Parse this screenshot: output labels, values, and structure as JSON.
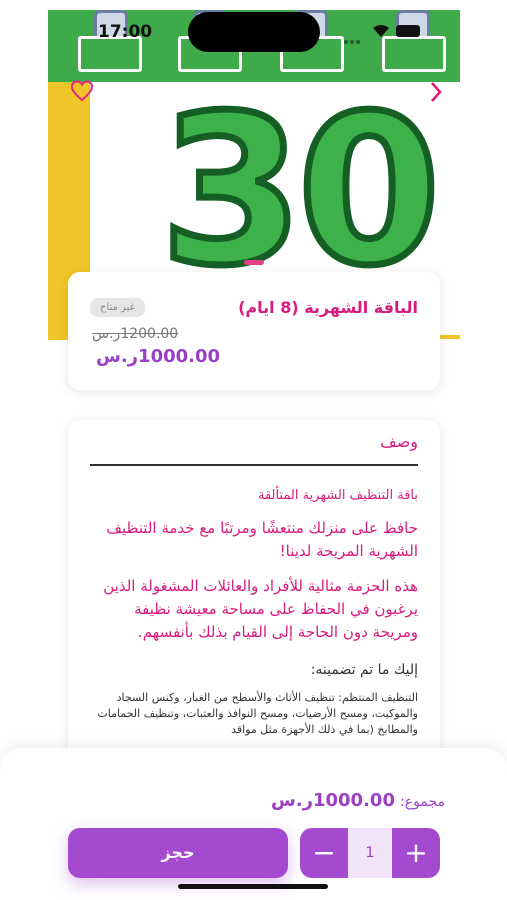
{
  "status_bar": {
    "time": "17:00"
  },
  "hero": {
    "calendar_number": "30"
  },
  "package": {
    "title": "الباقة الشهرية (8 ايام)",
    "availability_badge": "غير متاح",
    "old_price": "1200.00ر.س",
    "new_price": "1000.00ر.س"
  },
  "description": {
    "heading": "وصف",
    "intro": "باقة التنظيف الشهرية المتألقة",
    "para1": "حافظ على منزلك منتعشًا ومرتبًا مع خدمة التنظيف الشهرية المريحة لدينا!",
    "para2": "هذه الحزمة مثالية للأفراد والعائلات المشغولة الذين يرغبون في الحفاظ على مساحة معيشة نظيفة ومريحة دون الحاجة إلى القيام بذلك بأنفسهم.",
    "includes_heading": "إليك ما تم تضمينه:",
    "includes_text": "التنظيف المنتظم: تنظيف الأثاث والأسطح من الغبار، وكنس السجاد والموكيت، ومسح الأرضيات، ومسح النوافذ والعتبات، وتنظيف الحمامات والمطابخ (بما في ذلك الأجهزة مثل مواقد"
  },
  "footer": {
    "total_label": "مجموع:",
    "total_value": "1000.00ر.س",
    "book_label": "حجز",
    "quantity": "1",
    "minus_symbol": "−",
    "plus_symbol": "+"
  },
  "icons": {
    "favorite": "heart-icon",
    "next": "chevron-right-icon"
  },
  "colors": {
    "accent_pink": "#d81b7d",
    "accent_purple": "#a44ad0",
    "calendar_green": "#3eaa4a",
    "calendar_yellow": "#f1c527"
  }
}
